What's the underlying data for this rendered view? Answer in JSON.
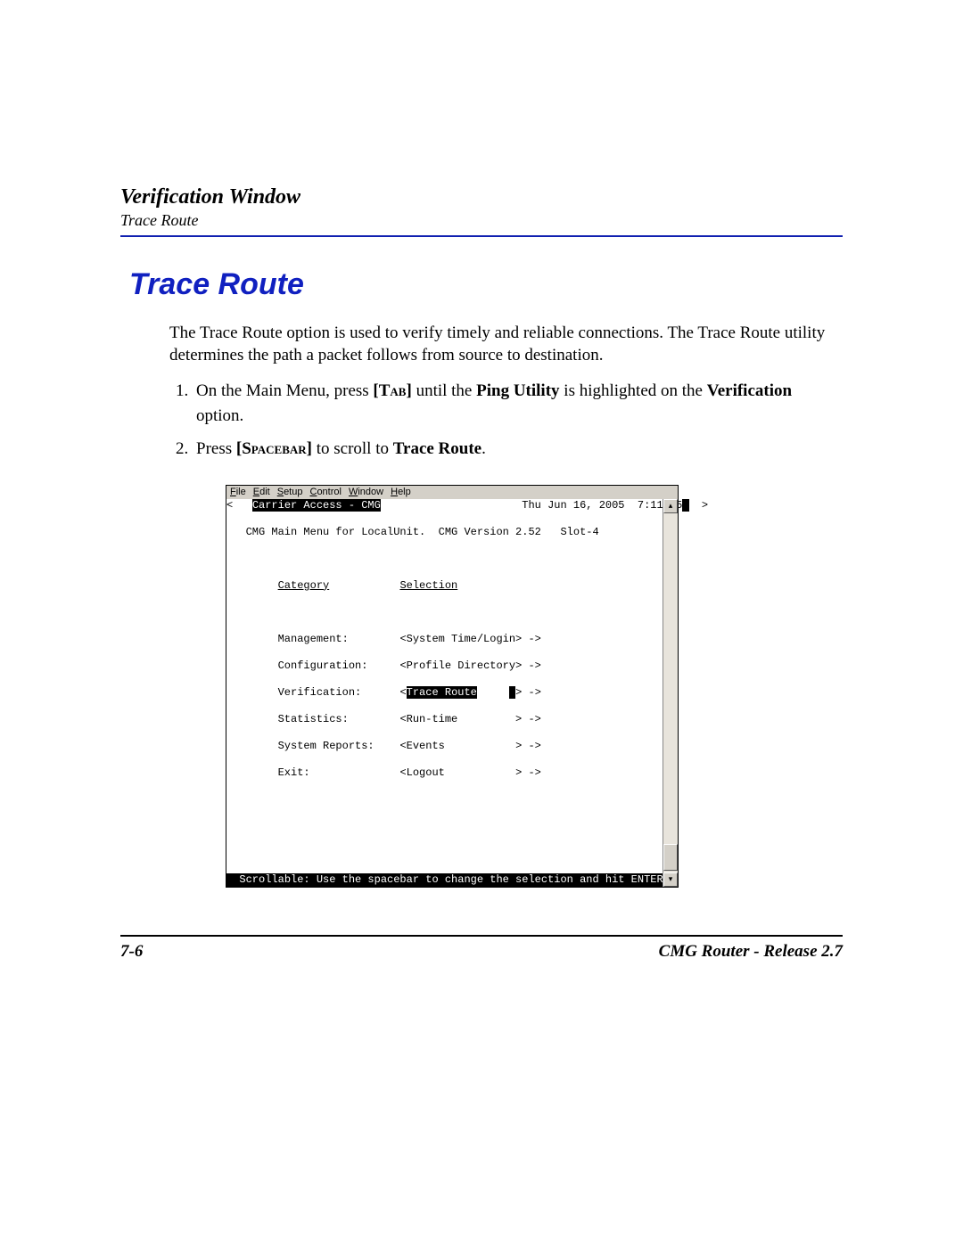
{
  "header": {
    "title": "Verification Window",
    "subtitle": "Trace Route"
  },
  "heading": "Trace Route",
  "intro": "The Trace Route option is used to verify timely and reliable connections. The Trace Route utility determines the path a packet follows from source to destination.",
  "steps": {
    "s1_a": "On the Main Menu, press ",
    "s1_key": "[Tab]",
    "s1_b": " until the ",
    "s1_bold1": "Ping Utility",
    "s1_c": " is highlighted on the ",
    "s1_bold2": "Verification",
    "s1_d": " option.",
    "s2_a": "Press ",
    "s2_key": "[Spacebar]",
    "s2_b": " to scroll to ",
    "s2_bold": "Trace Route",
    "s2_c": "."
  },
  "window": {
    "menus": {
      "file": "File",
      "edit": "Edit",
      "setup": "Setup",
      "control": "Control",
      "window": "Window",
      "help": "Help"
    },
    "terminal": {
      "titlebar_left": "Carrier Access - CMG",
      "titlebar_right": "Thu Jun 16, 2005  7:11:05",
      "subtitle": "   CMG Main Menu for LocalUnit.  CMG Version 2.52   Slot-4",
      "col_category": "Category",
      "col_selection": "Selection",
      "rows": {
        "r1c": "Management:",
        "r1s": "<System Time/Login> ->",
        "r2c": "Configuration:",
        "r2s": "<Profile Directory> ->",
        "r3c": "Verification:",
        "r3s_sel": "Trace Route",
        "r4c": "Statistics:",
        "r4s": "<Run-time         > ->",
        "r5c": "System Reports:",
        "r5s": "<Events           > ->",
        "r6c": "Exit:",
        "r6s": "<Logout           > ->"
      },
      "statusbar": "Scrollable: Use the spacebar to change the selection and hit ENTER."
    }
  },
  "footer": {
    "page": "7-6",
    "doc": "CMG Router - Release 2.7"
  }
}
